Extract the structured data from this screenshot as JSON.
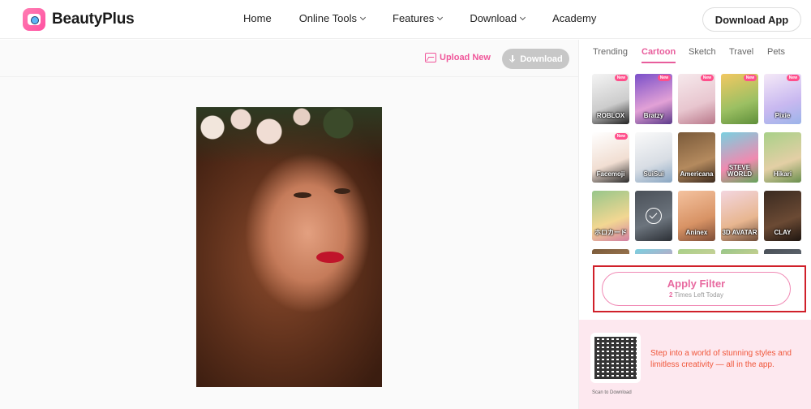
{
  "header": {
    "brand": "BeautyPlus",
    "nav": [
      {
        "label": "Home",
        "dropdown": false
      },
      {
        "label": "Online Tools",
        "dropdown": true
      },
      {
        "label": "Features",
        "dropdown": true
      },
      {
        "label": "Download",
        "dropdown": true
      },
      {
        "label": "Academy",
        "dropdown": false
      }
    ],
    "download_app": "Download App"
  },
  "toolbar": {
    "upload_new": "Upload New",
    "download": "Download"
  },
  "panel": {
    "tabs": [
      "Trending",
      "Cartoon",
      "Sketch",
      "Travel",
      "Pets"
    ],
    "active_tab": "Cartoon",
    "filters": [
      {
        "label": "ROBLOX",
        "new": true,
        "badge": "New"
      },
      {
        "label": "Bratzy",
        "new": true,
        "badge": "New"
      },
      {
        "label": "",
        "new": true,
        "badge": "New"
      },
      {
        "label": "",
        "new": true,
        "badge": "New"
      },
      {
        "label": "Pixie",
        "new": true,
        "badge": "New"
      },
      {
        "label": "Facemoji",
        "new": true,
        "badge": "New"
      },
      {
        "label": "SuiSui",
        "new": false
      },
      {
        "label": "Americana",
        "new": false
      },
      {
        "label": "STEVE WORLD",
        "new": false
      },
      {
        "label": "Hikari",
        "new": false
      },
      {
        "label": "ホロカード",
        "new": false
      },
      {
        "label": "",
        "new": false,
        "selected": true
      },
      {
        "label": "Aninex",
        "new": false
      },
      {
        "label": "3D AVATAR",
        "new": false
      },
      {
        "label": "CLAY",
        "new": false
      }
    ],
    "apply_filter": "Apply Filter",
    "times_left_count": "2",
    "times_left_text": "Times Left Today",
    "promo_text": "Step into a world of stunning styles and limitless creativity — all in the app.",
    "scan_label": "Scan to Download"
  },
  "colors": {
    "accent": "#e85d9c",
    "apply_highlight": "#d0202a",
    "promo_bg": "#fde8ef",
    "promo_text": "#f0563a"
  }
}
